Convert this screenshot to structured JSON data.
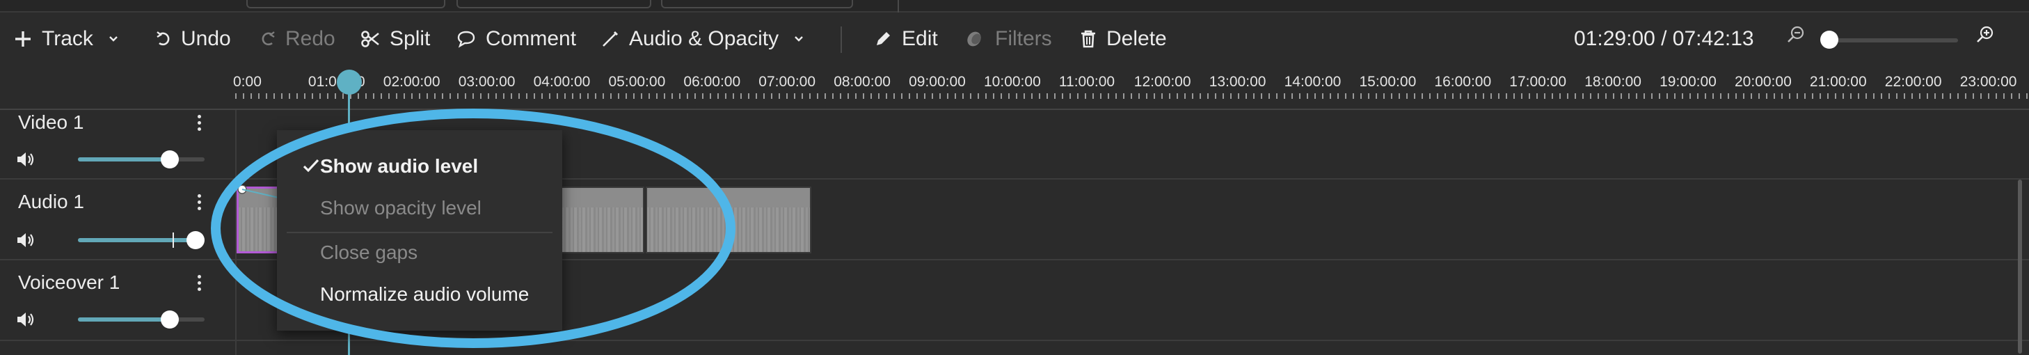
{
  "toolbar": {
    "track_label": "Track",
    "undo_label": "Undo",
    "redo_label": "Redo",
    "split_label": "Split",
    "comment_label": "Comment",
    "audio_opacity_label": "Audio & Opacity",
    "edit_label": "Edit",
    "filters_label": "Filters",
    "delete_label": "Delete",
    "timecode": "01:29:00 / 07:42:13"
  },
  "ruler": {
    "labels": [
      "0:00",
      "01:00:00",
      "02:00:00",
      "03:00:00",
      "04:00:00",
      "05:00:00",
      "06:00:00",
      "07:00:00",
      "08:00:00",
      "09:00:00",
      "10:00:00",
      "11:00:00",
      "12:00:00",
      "13:00:00",
      "14:00:00",
      "15:00:00",
      "16:00:00",
      "17:00:00",
      "18:00:00",
      "19:00:00",
      "20:00:00",
      "21:00:00",
      "22:00:00",
      "23:00:00"
    ]
  },
  "tracks": [
    {
      "name": "Video 1",
      "volume": 0.78
    },
    {
      "name": "Audio 1",
      "volume": 1.0
    },
    {
      "name": "Voiceover 1",
      "volume": 0.78
    }
  ],
  "menu": {
    "items": [
      {
        "label": "Show audio level",
        "checked": true,
        "enabled": true
      },
      {
        "label": "Show opacity level",
        "checked": false,
        "enabled": false
      },
      {
        "label": "Close gaps",
        "checked": false,
        "enabled": false
      },
      {
        "label": "Normalize audio volume",
        "checked": false,
        "enabled": true
      }
    ]
  },
  "colors": {
    "background": "#2b2b2b",
    "accent": "#5fb1c4",
    "highlight": "#4fb6e8",
    "selected_clip_border": "#b35ad6"
  },
  "icons": {
    "track": "plus-icon",
    "undo": "undo-icon",
    "redo": "redo-icon",
    "split": "scissors-icon",
    "comment": "speech-bubble-icon",
    "audio_opacity": "line-pen-icon",
    "edit": "pencil-icon",
    "filters": "filters-icon",
    "delete": "trash-icon",
    "zoom_out": "zoom-out-icon",
    "zoom_in": "zoom-in-icon",
    "speaker": "speaker-icon",
    "more": "kebab-icon"
  }
}
